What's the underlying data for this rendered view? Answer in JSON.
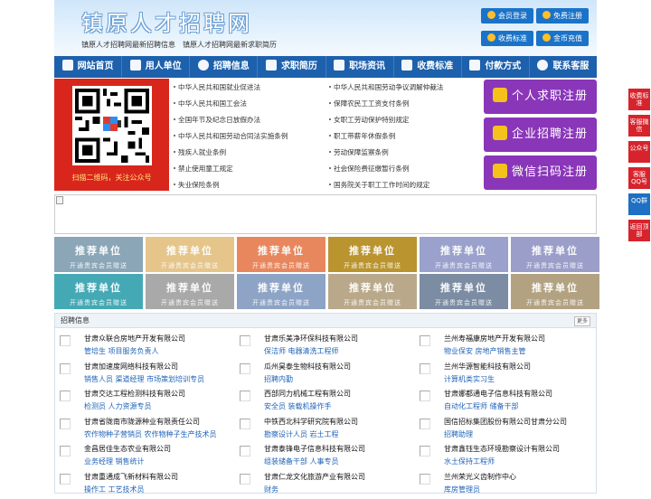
{
  "header": {
    "title": "镇原人才招聘网",
    "subtitle": "镇原人才招聘网最新招聘信息　镇原人才招聘网最新求职简历",
    "buttons": [
      "会员登录",
      "免费注册",
      "收费标准",
      "金币充值"
    ]
  },
  "nav": [
    "网站首页",
    "用人单位",
    "招聘信息",
    "求职简历",
    "职场资讯",
    "收费标准",
    "付款方式",
    "联系客服"
  ],
  "qr": {
    "caption": "扫描二维码，关注公众号"
  },
  "laws": [
    "中华人民共和国就业促进法",
    "中华人民共和国劳动争议调解仲裁法",
    "中华人民共和国工会法",
    "保障农民工工资支付条例",
    "全国年节及纪念日放假办法",
    "女职工劳动保护特别规定",
    "中华人民共和国劳动合同法实施条例",
    "职工带薪年休假条例",
    "残疾人就业条例",
    "劳动保障监察条例",
    "禁止使用童工规定",
    "社会保险费征缴暂行条例",
    "失业保险条例",
    "国务院关于职工工作时间的规定"
  ],
  "register": [
    "个人求职注册",
    "企业招聘注册",
    "微信扫码注册"
  ],
  "recommend": {
    "title": "推荐单位",
    "sub": "开通贵宾会员赠送",
    "colors": [
      "#8aa6b7",
      "#e6c58a",
      "#e8875e",
      "#b9942f",
      "#9aa1cc",
      "#9b9ec9",
      "#45a9b5",
      "#a9a9a9",
      "#8ea4c6",
      "#b9a98a",
      "#7b8ca3",
      "#b2a282"
    ]
  },
  "jobs": {
    "title": "招聘信息",
    "more": "更多",
    "items": [
      {
        "company": "甘肃众联合房地产开发有限公司",
        "positions": "管培生 项目服务负责人"
      },
      {
        "company": "甘肃乐美净环保科技有限公司",
        "positions": "保洁师 电器清洗工程师"
      },
      {
        "company": "兰州寿福康房地产开发有限公司",
        "positions": "物业保安 房地产销售主管"
      },
      {
        "company": "甘肃加速度网络科技有限公司",
        "positions": "销售人员 渠道经理 市场策划培训专员"
      },
      {
        "company": "瓜州昊泰生物科技有限公司",
        "positions": "招聘内勤"
      },
      {
        "company": "兰州华源智能科技有限公司",
        "positions": "计算机类实习生"
      },
      {
        "company": "甘肃交达工程检测科技有限公司",
        "positions": "检测员 人力资源专员"
      },
      {
        "company": "西部同力机械工程有限公司",
        "positions": "安全员 装载机操作手"
      },
      {
        "company": "甘肃娜都通电子信息科技有限公司",
        "positions": "自动化工程师 储备干部"
      },
      {
        "company": "甘肃省陇南市陇源种业有限责任公司",
        "positions": "农作物种子营销员 农作物种子生产技术员"
      },
      {
        "company": "中铁西北科学研究院有限公司",
        "positions": "勘察设计人员 岩土工程"
      },
      {
        "company": "国信招标集团股份有限公司甘肃分公司",
        "positions": "招聘助理"
      },
      {
        "company": "金昌居佳生态农业有限公司",
        "positions": "业务经理 销售统计"
      },
      {
        "company": "甘肃泰锋电子信息科技有限公司",
        "positions": "组装储备干部 人事专员"
      },
      {
        "company": "甘肃鑫钰生态环境勘察设计有限公司",
        "positions": "水土保持工程师"
      },
      {
        "company": "甘肃重通成飞新材料有限公司",
        "positions": "操作工 工艺技术员"
      },
      {
        "company": "甘肃仁龙文化旅游产业有限公司",
        "positions": "财务"
      },
      {
        "company": "兰州荣光义齿制作中心",
        "positions": "库房管理员"
      }
    ]
  },
  "side": [
    "收费标准",
    "客服微信",
    "公众号",
    "客服QQ号",
    "QQ群",
    "返回顶部"
  ]
}
